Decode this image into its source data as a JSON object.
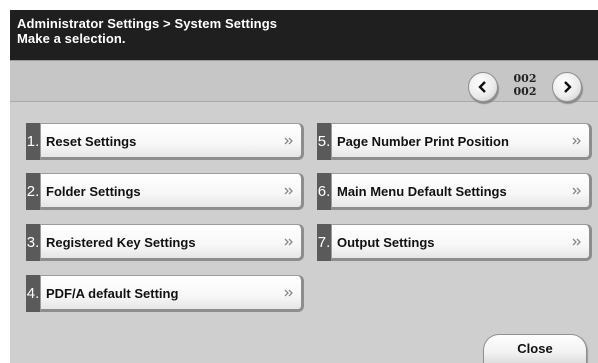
{
  "header": {
    "breadcrumb": "Administrator Settings > System Settings",
    "instruction": "Make a selection."
  },
  "pager": {
    "current": "002",
    "total": "002",
    "prev_icon": "chevron-left-icon",
    "next_icon": "chevron-right-icon"
  },
  "menu": {
    "items": [
      {
        "number": "1.",
        "label": "Reset Settings"
      },
      {
        "number": "2.",
        "label": "Folder Settings"
      },
      {
        "number": "3.",
        "label": "Registered Key Settings"
      },
      {
        "number": "4.",
        "label": "PDF/A default Setting"
      },
      {
        "number": "5.",
        "label": "Page Number Print Position"
      },
      {
        "number": "6.",
        "label": "Main Menu Default Settings"
      },
      {
        "number": "7.",
        "label": "Output Settings"
      }
    ],
    "arrow_icon": "double-chevron-right-icon"
  },
  "footer": {
    "close_label": "Close"
  },
  "colors": {
    "header_bg": "#1f1f1f",
    "panel_bg": "#cfcfcf",
    "number_tab": "#5a5a5a"
  }
}
